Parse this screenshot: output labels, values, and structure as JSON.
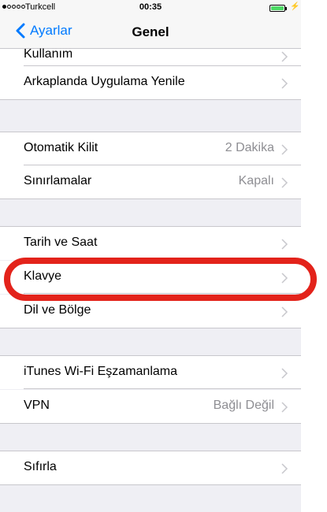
{
  "status": {
    "carrier": "Turkcell",
    "time": "00:35",
    "charging": "⚡",
    "battery_level": 1.0
  },
  "nav": {
    "back_label": "Ayarlar",
    "title": "Genel"
  },
  "rows": [
    {
      "label": "Kullanım",
      "value": ""
    },
    {
      "label": "Arkaplanda Uygulama Yenile",
      "value": ""
    },
    {
      "label": "Otomatik Kilit",
      "value": "2 Dakika"
    },
    {
      "label": "Sınırlamalar",
      "value": "Kapalı"
    },
    {
      "label": "Tarih ve Saat",
      "value": ""
    },
    {
      "label": "Klavye",
      "value": ""
    },
    {
      "label": "Dil ve Bölge",
      "value": ""
    },
    {
      "label": "iTunes Wi-Fi Eşzamanlama",
      "value": ""
    },
    {
      "label": "VPN",
      "value": "Bağlı Değil"
    },
    {
      "label": "Sıfırla",
      "value": ""
    }
  ],
  "colors": {
    "accent": "#007aff",
    "highlight": "#e3231b",
    "group_bg": "#efeff4"
  },
  "highlighted_row": "Klavye"
}
